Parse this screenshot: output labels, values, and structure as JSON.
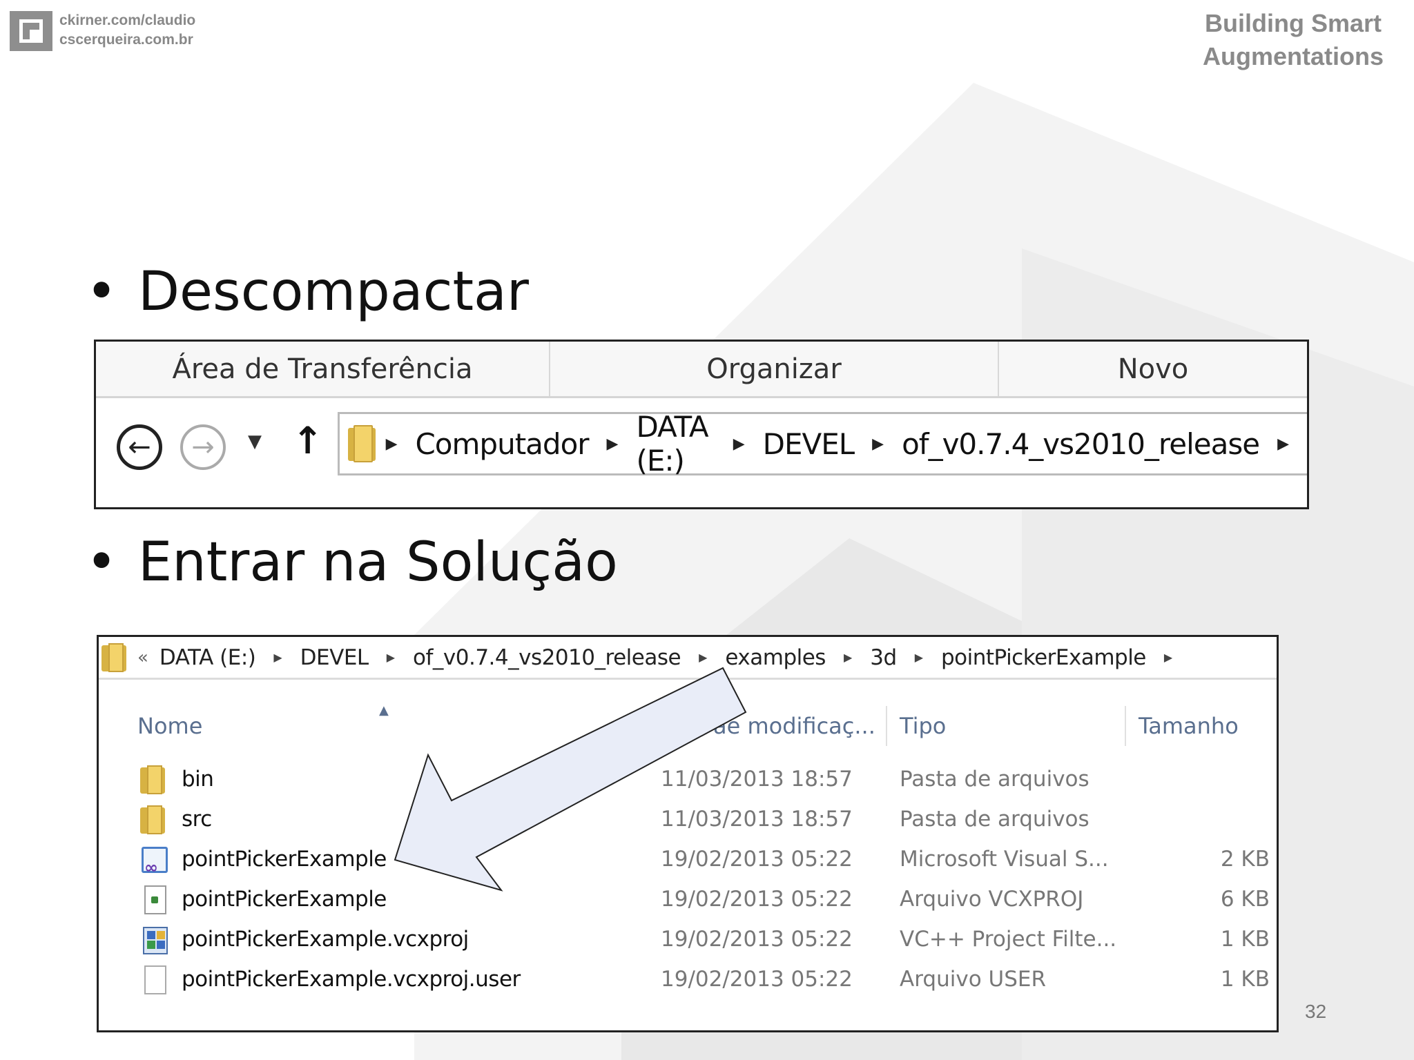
{
  "header": {
    "credit_line1": "ckirner.com/claudio",
    "credit_line2": "cscerqueira.com.br",
    "brand_line1": "Building Smart",
    "brand_line2": "Augmentations"
  },
  "bullets": [
    {
      "text": "Descompactar"
    },
    {
      "text": "Entrar na Solução"
    }
  ],
  "explorer_ribbon": {
    "groups": [
      "Área de Transferência",
      "Organizar",
      "Novo"
    ],
    "address_path": [
      "Computador",
      "DATA (E:)",
      "DEVEL",
      "of_v0.7.4_vs2010_release"
    ]
  },
  "folder_view": {
    "address_path": [
      "DATA (E:)",
      "DEVEL",
      "of_v0.7.4_vs2010_release",
      "examples",
      "3d",
      "pointPickerExample"
    ],
    "columns": {
      "name": "Nome",
      "date": "ae modificaç...",
      "type": "Tipo",
      "size": "Tamanho"
    },
    "rows": [
      {
        "icon": "folder-icon",
        "name": "bin",
        "date": "11/03/2013 18:57",
        "type": "Pasta de arquivos",
        "size": ""
      },
      {
        "icon": "folder-icon",
        "name": "src",
        "date": "11/03/2013 18:57",
        "type": "Pasta de arquivos",
        "size": ""
      },
      {
        "icon": "visual-studio-solution-icon",
        "name": "pointPickerExample",
        "date": "19/02/2013 05:22",
        "type": "Microsoft Visual S...",
        "size": "2 KB"
      },
      {
        "icon": "vcxproj-file-icon",
        "name": "pointPickerExample",
        "date": "19/02/2013 05:22",
        "type": "Arquivo VCXPROJ",
        "size": "6 KB"
      },
      {
        "icon": "project-filters-icon",
        "name": "pointPickerExample.vcxproj",
        "date": "19/02/2013 05:22",
        "type": "VC++ Project Filte...",
        "size": "1 KB"
      },
      {
        "icon": "blank-file-icon",
        "name": "pointPickerExample.vcxproj.user",
        "date": "19/02/2013 05:22",
        "type": "Arquivo USER",
        "size": "1 KB"
      }
    ]
  },
  "slide": {
    "page_number": "32"
  },
  "colors": {
    "arrow_fill": "#e9edf8",
    "header_gray": "#8a8a8a"
  }
}
